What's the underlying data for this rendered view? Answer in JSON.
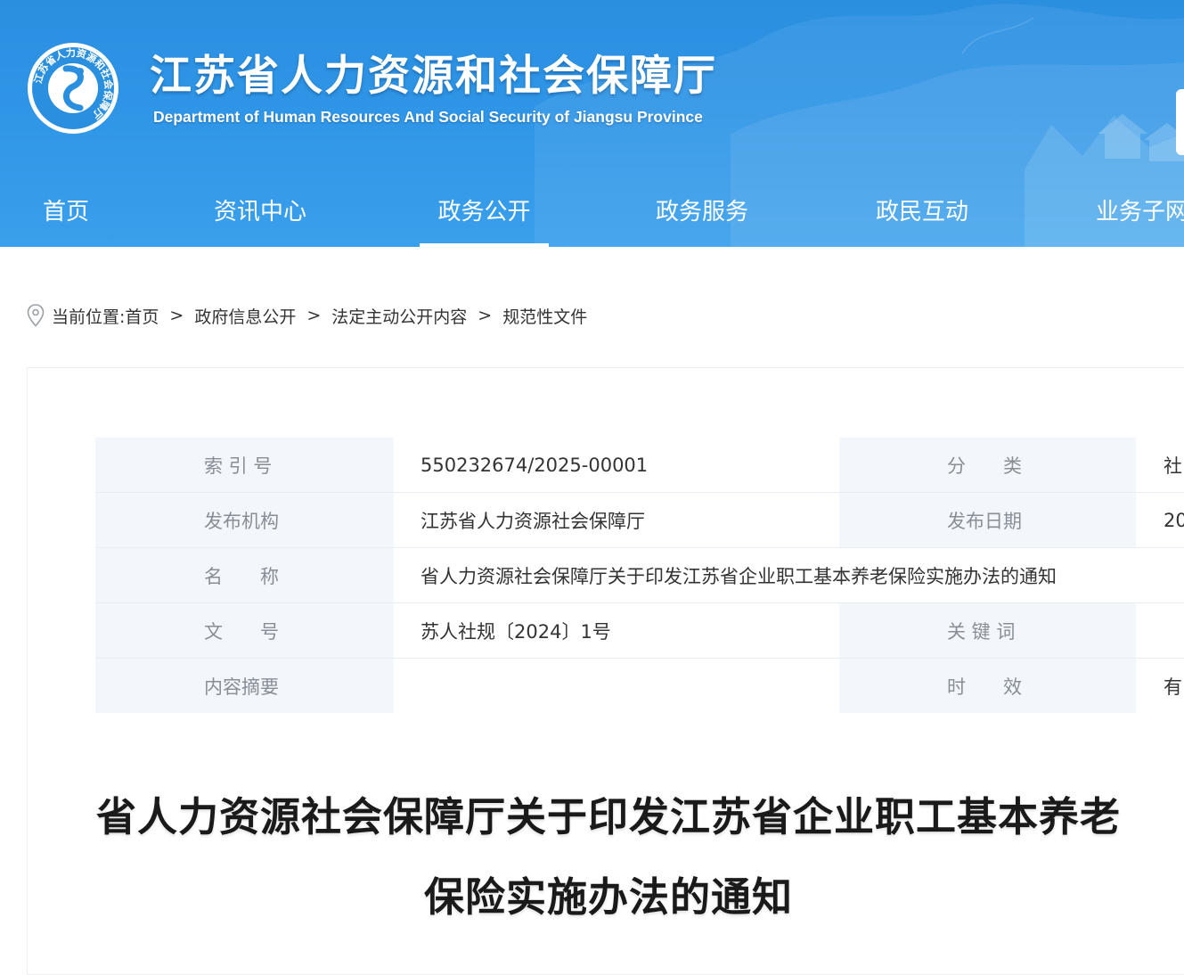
{
  "header": {
    "title": "江苏省人力资源和社会保障厅",
    "subtitle": "Department of Human Resources And Social Security of Jiangsu Province",
    "logo_text": "江苏省人力资源和社会保障厅"
  },
  "nav": {
    "items": [
      {
        "label": "首页"
      },
      {
        "label": "资讯中心"
      },
      {
        "label": "政务公开"
      },
      {
        "label": "政务服务"
      },
      {
        "label": "政民互动"
      },
      {
        "label": "业务子网"
      }
    ],
    "active": "政务公开"
  },
  "breadcrumb": {
    "prefix": "当前位置:",
    "items": [
      "首页",
      "政府信息公开",
      "法定主动公开内容",
      "规范性文件"
    ],
    "separator": ">"
  },
  "info": {
    "rows": [
      {
        "label": "索 引 号",
        "value": "550232674/2025-00001",
        "label2": "分　　类",
        "value2": "社"
      },
      {
        "label": "发布机构",
        "value": "江苏省人力资源社会保障厅",
        "label2": "发布日期",
        "value2": "20"
      },
      {
        "label": "名　　称",
        "value": "省人力资源社会保障厅关于印发江苏省企业职工基本养老保险实施办法的通知"
      },
      {
        "label": "文　　号",
        "value": "苏人社规〔2024〕1号",
        "label2": "关 键 词",
        "value2": ""
      },
      {
        "label": "内容摘要",
        "value": "",
        "label2": "时　　效",
        "value2": "有"
      }
    ]
  },
  "document": {
    "title_line1": "省人力资源社会保障厅关于印发江苏省企业职工基本养老",
    "title_line2": "保险实施办法的通知"
  },
  "colors": {
    "header_blue": "#2f95e6",
    "label_bg": "#f3f7fb",
    "label_text": "#888e96"
  }
}
